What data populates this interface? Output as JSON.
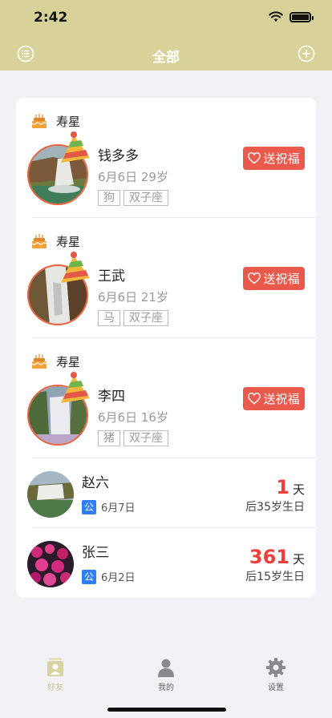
{
  "status": {
    "time": "2:42"
  },
  "nav": {
    "title": "全部",
    "left_icon": "list-icon",
    "right_icon": "plus-circle-icon"
  },
  "birthdays": [
    {
      "label": "寿星",
      "name": "钱多多",
      "meta": "6月6日 29岁",
      "tags": [
        "狗",
        "双子座"
      ],
      "button": "送祝福"
    },
    {
      "label": "寿星",
      "name": "王武",
      "meta": "6月6日 21岁",
      "tags": [
        "马",
        "双子座"
      ],
      "button": "送祝福"
    },
    {
      "label": "寿星",
      "name": "李四",
      "meta": "6月6日 16岁",
      "tags": [
        "猪",
        "双子座"
      ],
      "button": "送祝福"
    }
  ],
  "upcoming": [
    {
      "name": "赵六",
      "badge": "公",
      "date": "6月7日",
      "days": "1",
      "unit": "天",
      "after": "后35岁生日"
    },
    {
      "name": "张三",
      "badge": "公",
      "date": "6月2日",
      "days": "361",
      "unit": "天",
      "after": "后15岁生日"
    }
  ],
  "tabs": [
    {
      "label": "好友",
      "icon": "friends-icon",
      "active": true
    },
    {
      "label": "我的",
      "icon": "person-icon",
      "active": false
    },
    {
      "label": "设置",
      "icon": "gear-icon",
      "active": false
    }
  ],
  "colors": {
    "header": "#d6d29a",
    "accent_red": "#ea5a4c",
    "days_red": "#ee3f3a",
    "badge_blue": "#2f7ef5",
    "tab_active": "#cbc58a"
  }
}
